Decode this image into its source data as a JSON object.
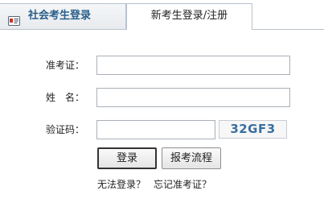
{
  "tabs": [
    {
      "label": "社会考生登录",
      "active": true
    },
    {
      "label": "新考生登录/注册",
      "active": false
    }
  ],
  "form": {
    "ticket_label": "准考证：",
    "name_label": "姓　名：",
    "captcha_label": "验证码：",
    "ticket_value": "",
    "name_value": "",
    "captcha_value": "",
    "captcha_text": "32GF3"
  },
  "buttons": {
    "login": "登录",
    "process": "报考流程"
  },
  "links": {
    "cannot_login": "无法登录？",
    "forgot_ticket": "忘记准考证？"
  },
  "colors": {
    "accent": "#2a5f8a",
    "captcha_text": "#3a6fa0",
    "border": "#a9b0b8"
  }
}
